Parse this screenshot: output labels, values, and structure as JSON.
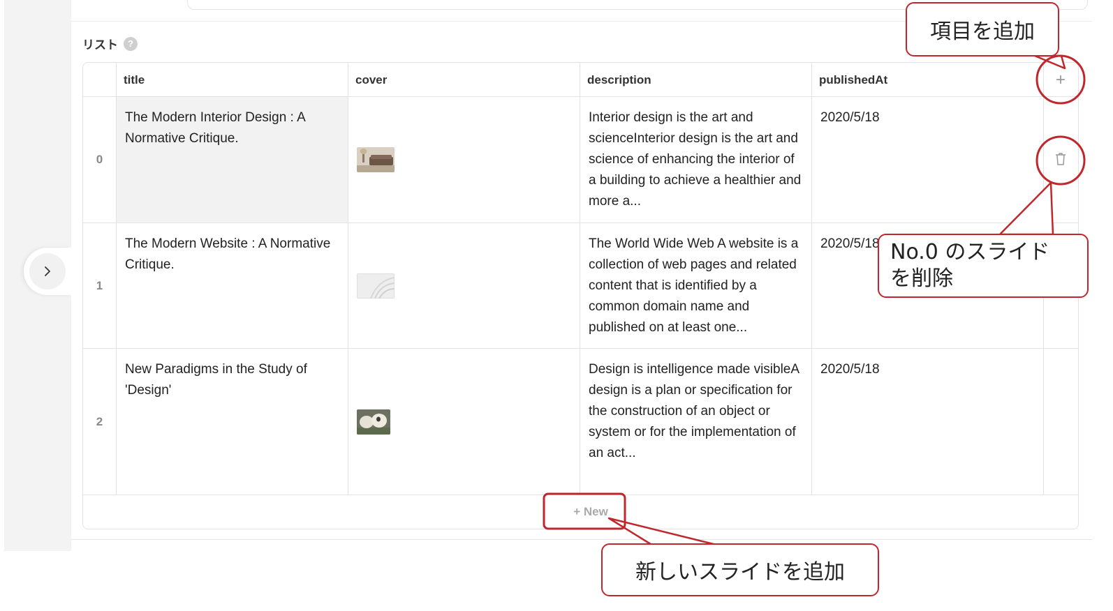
{
  "section": {
    "label": "リスト",
    "help_icon": "?"
  },
  "table": {
    "columns": [
      "title",
      "cover",
      "description",
      "publishedAt"
    ],
    "add_column_icon": "+",
    "rows": [
      {
        "index": "0",
        "title": "The Modern Interior Design : A Normative Critique.",
        "description": "Interior design is the art and scienceInterior design is the art and science of enhancing the interior of a building to achieve a healthier and more a...",
        "publishedAt": "2020/5/18"
      },
      {
        "index": "1",
        "title": "The Modern Website : A Normative Critique.",
        "description": "The World Wide Web A website is a collection of web pages and related content that is identified by a common domain name and published on at least one...",
        "publishedAt": "2020/5/18"
      },
      {
        "index": "2",
        "title": "New Paradigms in the Study of 'Design'",
        "description": "Design is intelligence made visibleA design is a plan or specification for the construction of an object or system or for the implementation of an act...",
        "publishedAt": "2020/5/18"
      }
    ],
    "new_button": "+ New"
  },
  "callouts": {
    "add_item": "項目を追加",
    "delete_slide_line1": "No.0 のスライド",
    "delete_slide_line2": "を削除",
    "add_slide": "新しいスライドを追加"
  },
  "colors": {
    "annotation_red": "#c0272d",
    "border": "#e3e3e3",
    "highlight": "#f2f2f2"
  }
}
